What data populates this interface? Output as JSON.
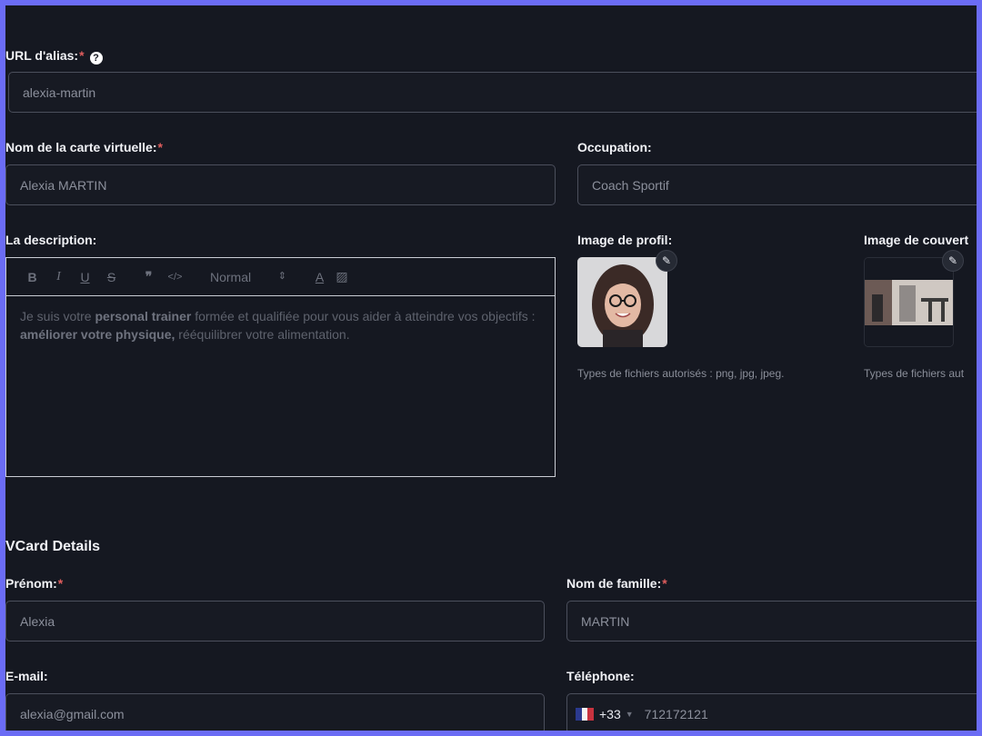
{
  "alias": {
    "label": "URL d'alias:",
    "required": "*",
    "value": "alexia-martin"
  },
  "card_name": {
    "label": "Nom de la carte virtuelle:",
    "required": "*",
    "value": "Alexia MARTIN"
  },
  "occupation": {
    "label": "Occupation:",
    "value": "Coach Sportif"
  },
  "description": {
    "label": "La description:",
    "toolbar": {
      "bold": "B",
      "italic": "I",
      "underline": "U",
      "strike": "S",
      "quote": "❞",
      "code": "</>",
      "format": "Normal",
      "format_arrow": "⇕",
      "color": "A",
      "background": "▨"
    },
    "text_1": "Je suis votre ",
    "bold_1": "personal trainer",
    "text_2": " formée et qualifiée pour vous aider à atteindre vos objectifs : ",
    "bold_2": "améliorer votre physique,",
    "text_3": " rééquilibrer votre alimentation."
  },
  "profile_image": {
    "label": "Image de profil:",
    "hint": "Types de fichiers autorisés : png, jpg, jpeg.",
    "edit_icon": "pencil-icon"
  },
  "cover_image": {
    "label": "Image de couvert",
    "hint": "Types de fichiers aut",
    "edit_icon": "pencil-icon"
  },
  "vcard": {
    "title": "VCard Details"
  },
  "first_name": {
    "label": "Prénom:",
    "required": "*",
    "value": "Alexia"
  },
  "last_name": {
    "label": "Nom de famille:",
    "required": "*",
    "value": "MARTIN"
  },
  "email": {
    "label": "E-mail:",
    "value": "alexia@gmail.com"
  },
  "phone": {
    "label": "Téléphone:",
    "dial_code": "+33",
    "value": "712172121",
    "flag": "FR"
  },
  "colors": {
    "frame": "#6b6cf5",
    "background": "#151821",
    "required": "#e05d5d"
  }
}
